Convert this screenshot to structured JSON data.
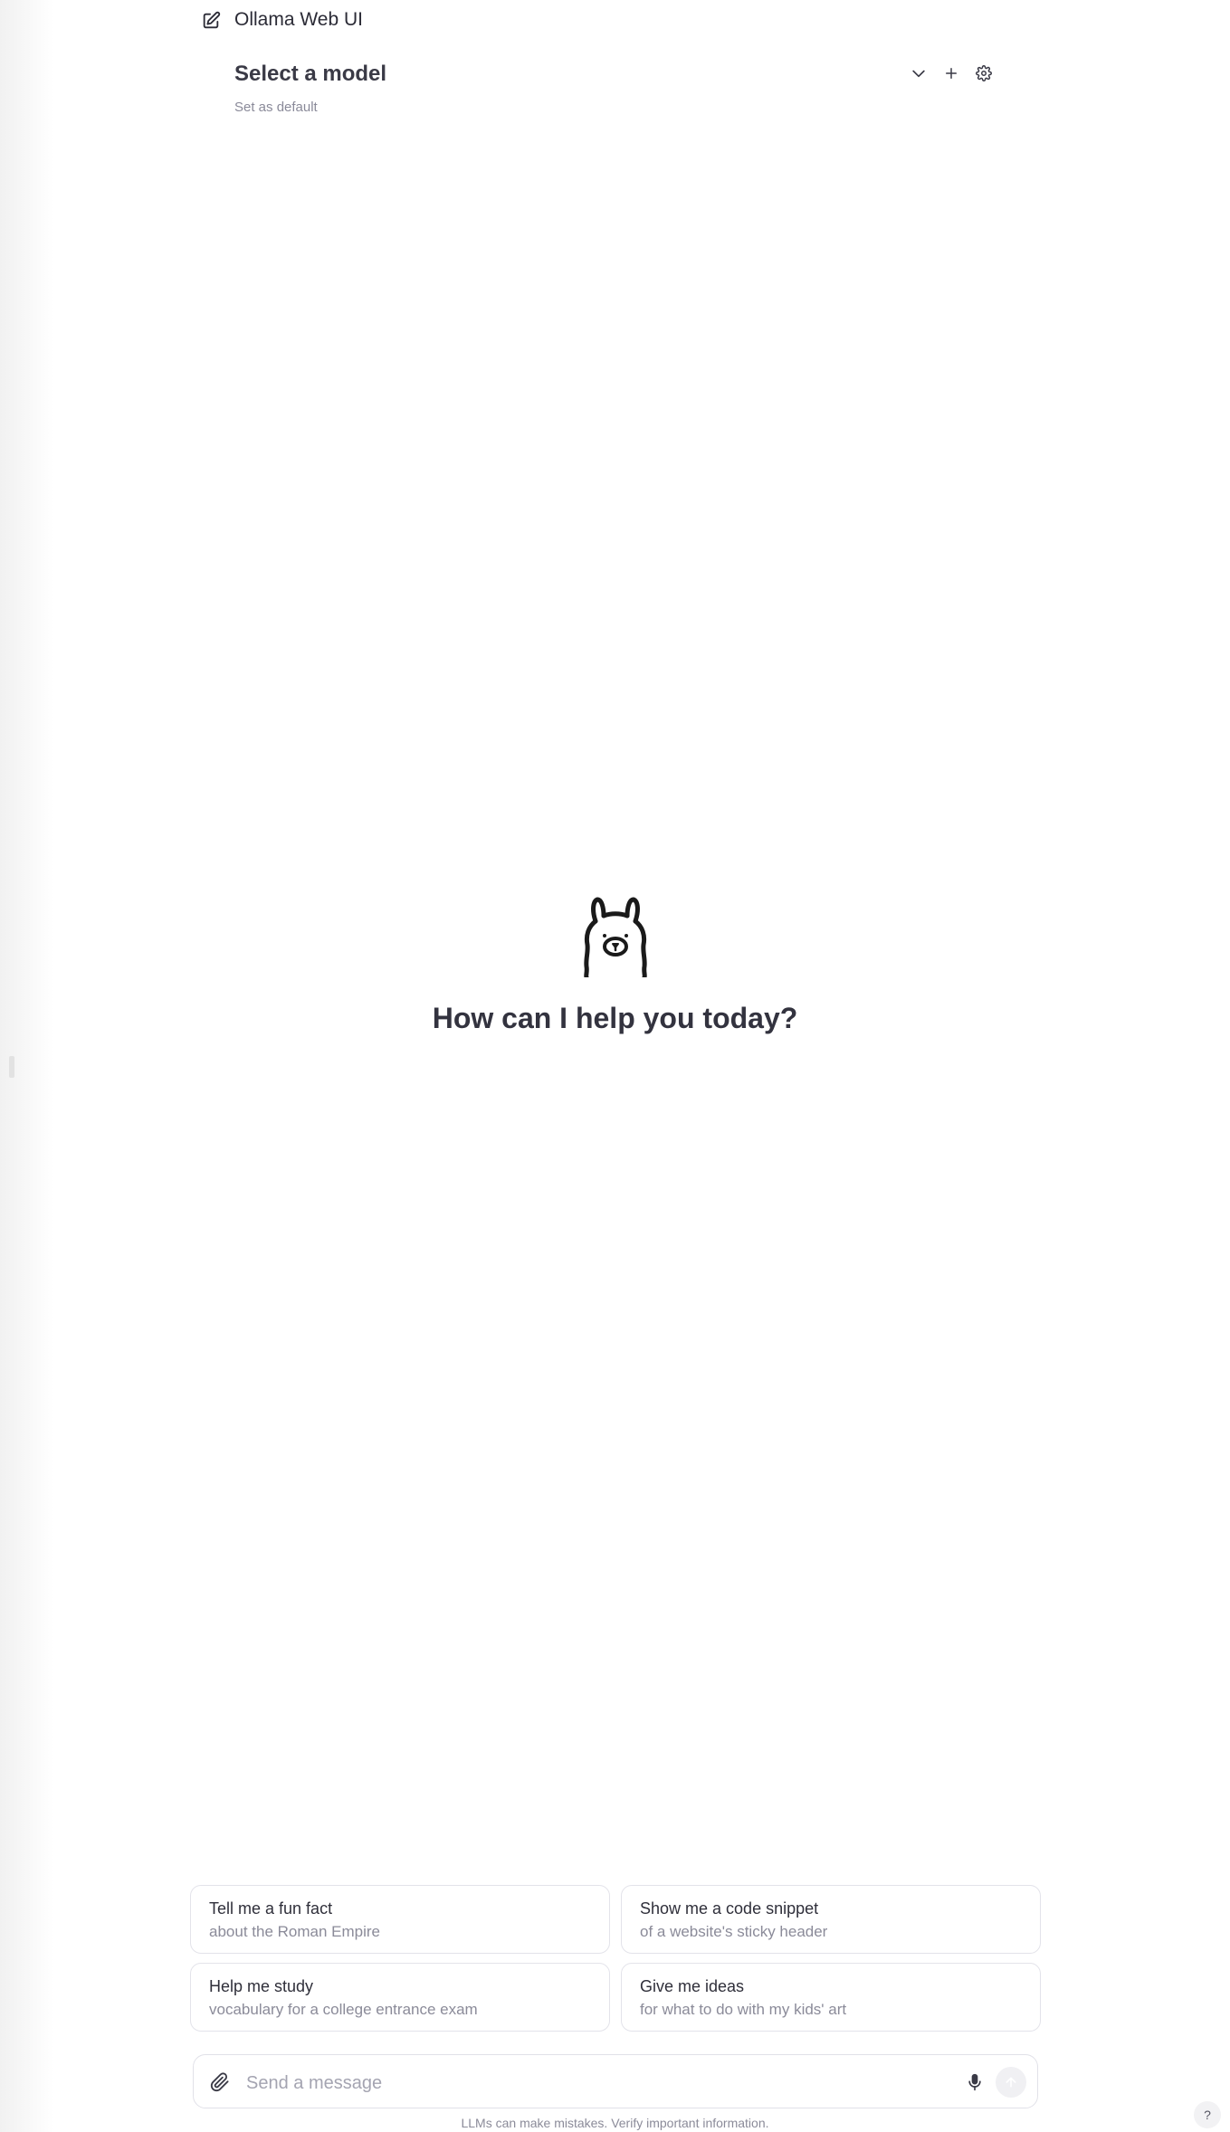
{
  "header": {
    "app_title": "Ollama Web UI",
    "new_chat_icon": "pencil-square-icon"
  },
  "model": {
    "selector_label": "Select a model",
    "set_default": "Set as default",
    "icons": [
      "chevron-down-icon",
      "plus-icon",
      "gear-icon"
    ]
  },
  "hero": {
    "logo": "ollama-llama-logo",
    "title": "How can I help you today?"
  },
  "suggestions": [
    {
      "title": "Tell me a fun fact",
      "subtitle": "about the Roman Empire"
    },
    {
      "title": "Show me a code snippet",
      "subtitle": "of a website's sticky header"
    },
    {
      "title": "Help me study",
      "subtitle": "vocabulary for a college entrance exam"
    },
    {
      "title": "Give me ideas",
      "subtitle": "for what to do with my kids' art"
    }
  ],
  "composer": {
    "placeholder": "Send a message",
    "value": "",
    "icons": [
      "paperclip-icon",
      "microphone-icon",
      "arrow-up-icon"
    ]
  },
  "footer": {
    "disclaimer": "LLMs can make mistakes. Verify important information.",
    "help_label": "?"
  },
  "colors": {
    "text": "#2f2f3a",
    "muted": "#8b8b99",
    "border": "#e3e3ea",
    "send_bg": "#f0f0f3"
  }
}
